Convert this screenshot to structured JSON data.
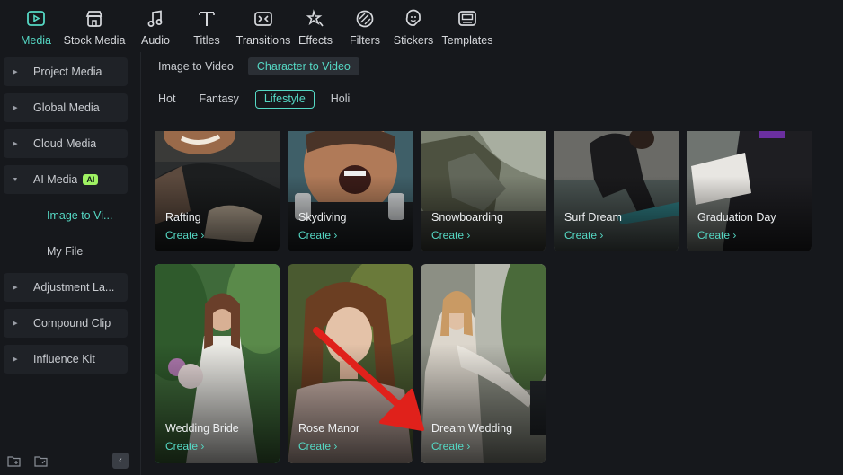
{
  "toolbar": {
    "items": [
      {
        "label": "Media",
        "icon": "media-icon"
      },
      {
        "label": "Stock Media",
        "icon": "stock-media-icon"
      },
      {
        "label": "Audio",
        "icon": "audio-icon"
      },
      {
        "label": "Titles",
        "icon": "titles-icon"
      },
      {
        "label": "Transitions",
        "icon": "transitions-icon"
      },
      {
        "label": "Effects",
        "icon": "effects-icon"
      },
      {
        "label": "Filters",
        "icon": "filters-icon"
      },
      {
        "label": "Stickers",
        "icon": "stickers-icon"
      },
      {
        "label": "Templates",
        "icon": "templates-icon"
      }
    ],
    "active": "Media"
  },
  "sidebar": {
    "items": [
      {
        "label": "Project Media"
      },
      {
        "label": "Global Media"
      },
      {
        "label": "Cloud Media"
      },
      {
        "label": "AI Media",
        "badge": "AI"
      },
      {
        "label": "Image to Vi..."
      },
      {
        "label": "My File"
      },
      {
        "label": "Adjustment La..."
      },
      {
        "label": "Compound Clip"
      },
      {
        "label": "Influence Kit"
      }
    ],
    "active": "Image to Vi..."
  },
  "tabs": [
    {
      "label": "Image to Video"
    },
    {
      "label": "Character to Video"
    }
  ],
  "active_tab": "Character to Video",
  "categories": [
    {
      "label": "Hot"
    },
    {
      "label": "Fantasy"
    },
    {
      "label": "Lifestyle"
    },
    {
      "label": "Holi"
    }
  ],
  "active_category": "Lifestyle",
  "cards": [
    {
      "name": "Rafting",
      "action": "Create ›"
    },
    {
      "name": "Skydiving",
      "action": "Create ›"
    },
    {
      "name": "Snowboarding",
      "action": "Create ›"
    },
    {
      "name": "Surf Dream",
      "action": "Create ›"
    },
    {
      "name": "Graduation Day",
      "action": "Create ›"
    },
    {
      "name": "Wedding Bride",
      "action": "Create ›"
    },
    {
      "name": "Rose Manor",
      "action": "Create ›"
    },
    {
      "name": "Dream Wedding",
      "action": "Create ›"
    }
  ],
  "selected_card": "Wedding Bride",
  "colors": {
    "accent": "#55d8c4",
    "ai_badge": "#9ff263",
    "annotation_arrow": "#e0211b",
    "background": "#16181c"
  }
}
